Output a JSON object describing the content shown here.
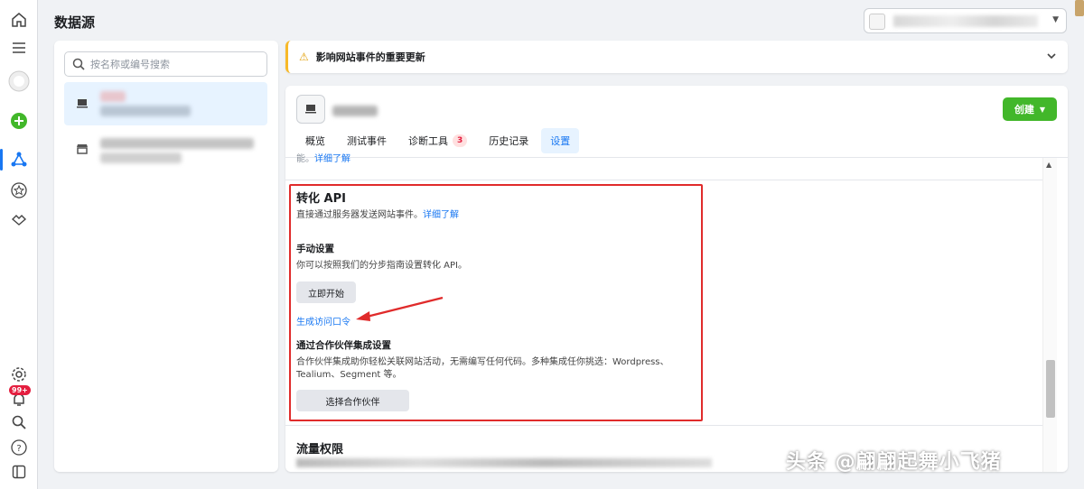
{
  "header": {
    "title": "数据源"
  },
  "left": {
    "search_placeholder": "按名称或编号搜索"
  },
  "notice": {
    "text": "影响网站事件的重要更新"
  },
  "main": {
    "create_label": "创建",
    "tabs": [
      {
        "label": "概览"
      },
      {
        "label": "测试事件"
      },
      {
        "label": "诊断工具",
        "count": "3"
      },
      {
        "label": "历史记录"
      },
      {
        "label": "设置"
      }
    ],
    "cutoff_prefix": "能。",
    "cutoff_link": "详细了解",
    "conversion_api": {
      "title": "转化 API",
      "desc": "直接通过服务器发送网站事件。",
      "learn_more": "详细了解",
      "manual_title": "手动设置",
      "manual_desc": "你可以按照我们的分步指南设置转化 API。",
      "start_button": "立即开始",
      "token_link": "生成访问口令",
      "partner_title": "通过合作伙伴集成设置",
      "partner_desc_1": "合作伙伴集成助你轻松关联网站活动，无需编写任何代码。多种集成任你挑选：Wordpress、",
      "partner_desc_2": "Tealium、Segment 等。",
      "partner_button": "选择合作伙伴"
    },
    "traffic_title": "流量权限"
  },
  "rail": {
    "notification_badge": "99+"
  },
  "watermark": "头条 @翩翩起舞小飞猪",
  "colors": {
    "accent": "#1877f2",
    "create": "#42b72a",
    "highlight": "#e02b2b",
    "warning": "#f7b928"
  }
}
